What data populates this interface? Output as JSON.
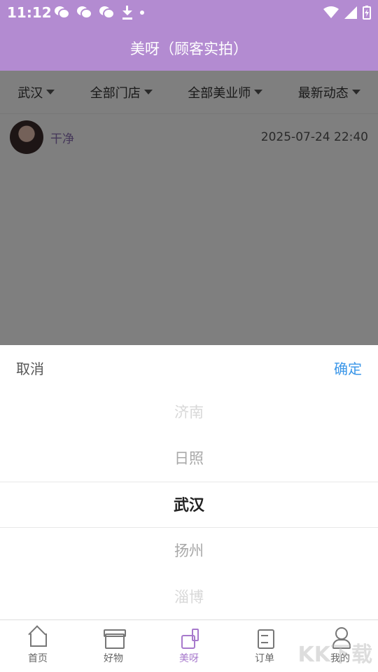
{
  "status_bar": {
    "time": "11:12"
  },
  "header": {
    "title": "美呀（顾客实拍）"
  },
  "filters": [
    {
      "label": "武汉"
    },
    {
      "label": "全部门店"
    },
    {
      "label": "全部美业师"
    },
    {
      "label": "最新动态"
    }
  ],
  "post": {
    "username": "干净",
    "timestamp": "2025-07-24 22:40"
  },
  "picker": {
    "cancel_label": "取消",
    "confirm_label": "确定",
    "options": [
      "济南",
      "日照",
      "武汉",
      "扬州",
      "淄博"
    ],
    "selected": "武汉"
  },
  "bottom_nav": [
    {
      "label": "首页",
      "icon": "home-icon"
    },
    {
      "label": "好物",
      "icon": "gift-box-icon"
    },
    {
      "label": "美呀",
      "icon": "nail-polish-icon"
    },
    {
      "label": "订单",
      "icon": "clipboard-icon"
    },
    {
      "label": "我的",
      "icon": "user-icon"
    }
  ],
  "colors": {
    "brand": "#b38bd1",
    "active_tab": "#a779cc",
    "confirm": "#3a96e8"
  },
  "watermark": "KK下载"
}
